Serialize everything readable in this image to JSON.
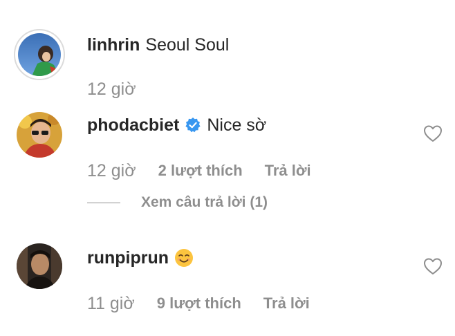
{
  "comments": [
    {
      "username": "linhrin",
      "text": "Seoul Soul",
      "time": "12 giờ"
    },
    {
      "username": "phodacbiet",
      "verified": true,
      "verified_icon": "verified-badge-icon",
      "text": "Nice sờ",
      "time": "12 giờ",
      "likes": "2 lượt thích",
      "reply": "Trả lời",
      "view_replies": "Xem câu trả lời (1)"
    },
    {
      "username": "runpiprun",
      "emoji": "smiling-face-emoji",
      "time": "11 giờ",
      "likes": "9 lượt thích",
      "reply": "Trả lời"
    }
  ],
  "icons": {
    "like": "heart-outline-icon"
  },
  "colors": {
    "text_primary": "#262626",
    "text_secondary": "#8e8e8e",
    "verified_blue": "#3897f0",
    "ring": "#dbdbdb"
  }
}
